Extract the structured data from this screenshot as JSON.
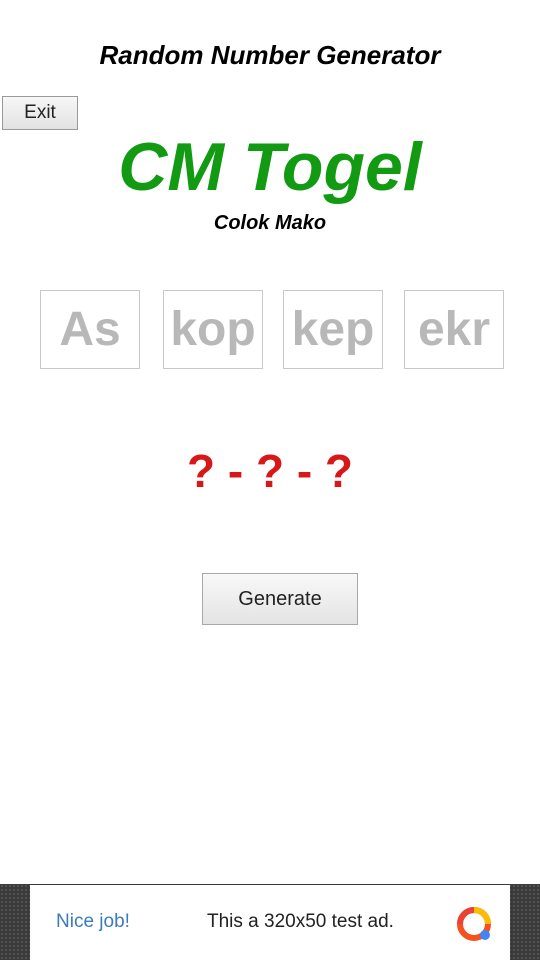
{
  "header": {
    "title": "Random Number Generator"
  },
  "exit_button": {
    "label": "Exit"
  },
  "brand": {
    "title": "CM Togel",
    "subtitle": "Colok Mako"
  },
  "digit_fields": [
    {
      "placeholder": "As",
      "value": ""
    },
    {
      "placeholder": "kop",
      "value": ""
    },
    {
      "placeholder": "kep",
      "value": ""
    },
    {
      "placeholder": "ekr",
      "value": ""
    }
  ],
  "result": {
    "text": "? - ? - ?"
  },
  "generate_button": {
    "label": "Generate"
  },
  "ad": {
    "headline": "Nice job!",
    "body": "This a 320x50 test ad.",
    "logo_icon": "ad-choices-logo-icon"
  },
  "colors": {
    "brand_green": "#129a12",
    "result_red": "#d81818",
    "ad_link_blue": "#3a7bc0"
  }
}
